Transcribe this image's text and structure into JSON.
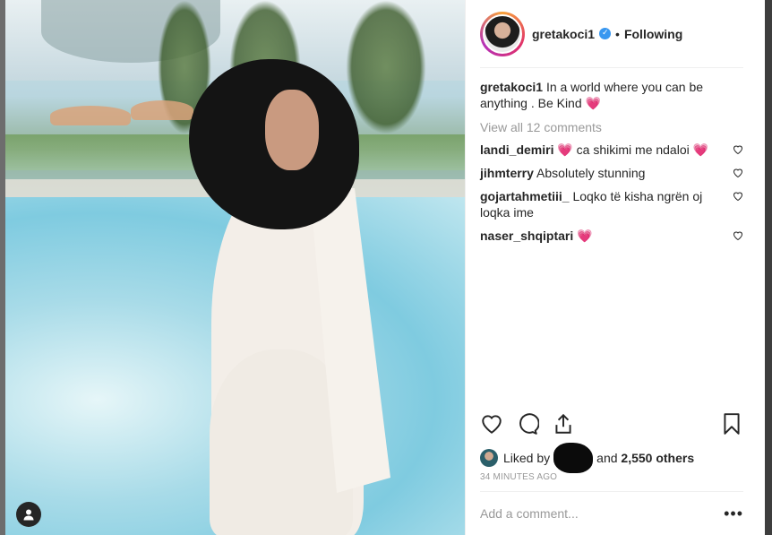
{
  "post": {
    "username": "gretakoci1",
    "follow_status": "Following",
    "separator": "•",
    "caption": "In a world where you can be anything . Be Kind 💗",
    "view_all_comments": "View all 12 comments",
    "comments": [
      {
        "user": "landi_demiri",
        "text": "💗 ca shikimi me ndaloi 💗"
      },
      {
        "user": "jihmterry",
        "text": "Absolutely stunning"
      },
      {
        "user": "gojartahmetiii_",
        "text": "Loqko të kisha ngrën oj loqka ime"
      },
      {
        "user": "naser_shqiptari",
        "text": "💗"
      }
    ],
    "liked_by_prefix": "Liked by",
    "liked_by_suffix_and": "and",
    "liked_by_others": "2,550 others",
    "timestamp": "34 MINUTES AGO",
    "add_comment_placeholder": "Add a comment...",
    "more_label": "•••"
  },
  "colors": {
    "accent": "#3897f0",
    "text": "#262626",
    "muted": "#999999"
  },
  "icons": {
    "like": "heart-icon",
    "comment": "comment-icon",
    "share": "share-icon",
    "save": "bookmark-icon",
    "tag": "user-tag-icon"
  }
}
